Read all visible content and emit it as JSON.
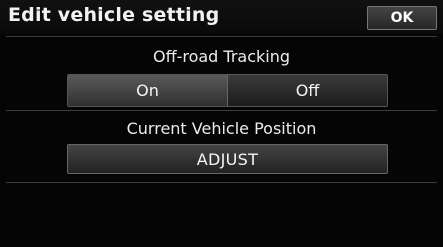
{
  "header": {
    "title": "Edit vehicle setting",
    "ok_label": "OK"
  },
  "off_road_tracking": {
    "label": "Off-road Tracking",
    "options": [
      "On",
      "Off"
    ],
    "selected": "On"
  },
  "vehicle_position": {
    "label": "Current Vehicle Position",
    "button_label": "ADJUST"
  },
  "colors": {
    "background": "#050505",
    "text": "#ffffff",
    "button_face": "#333333"
  }
}
